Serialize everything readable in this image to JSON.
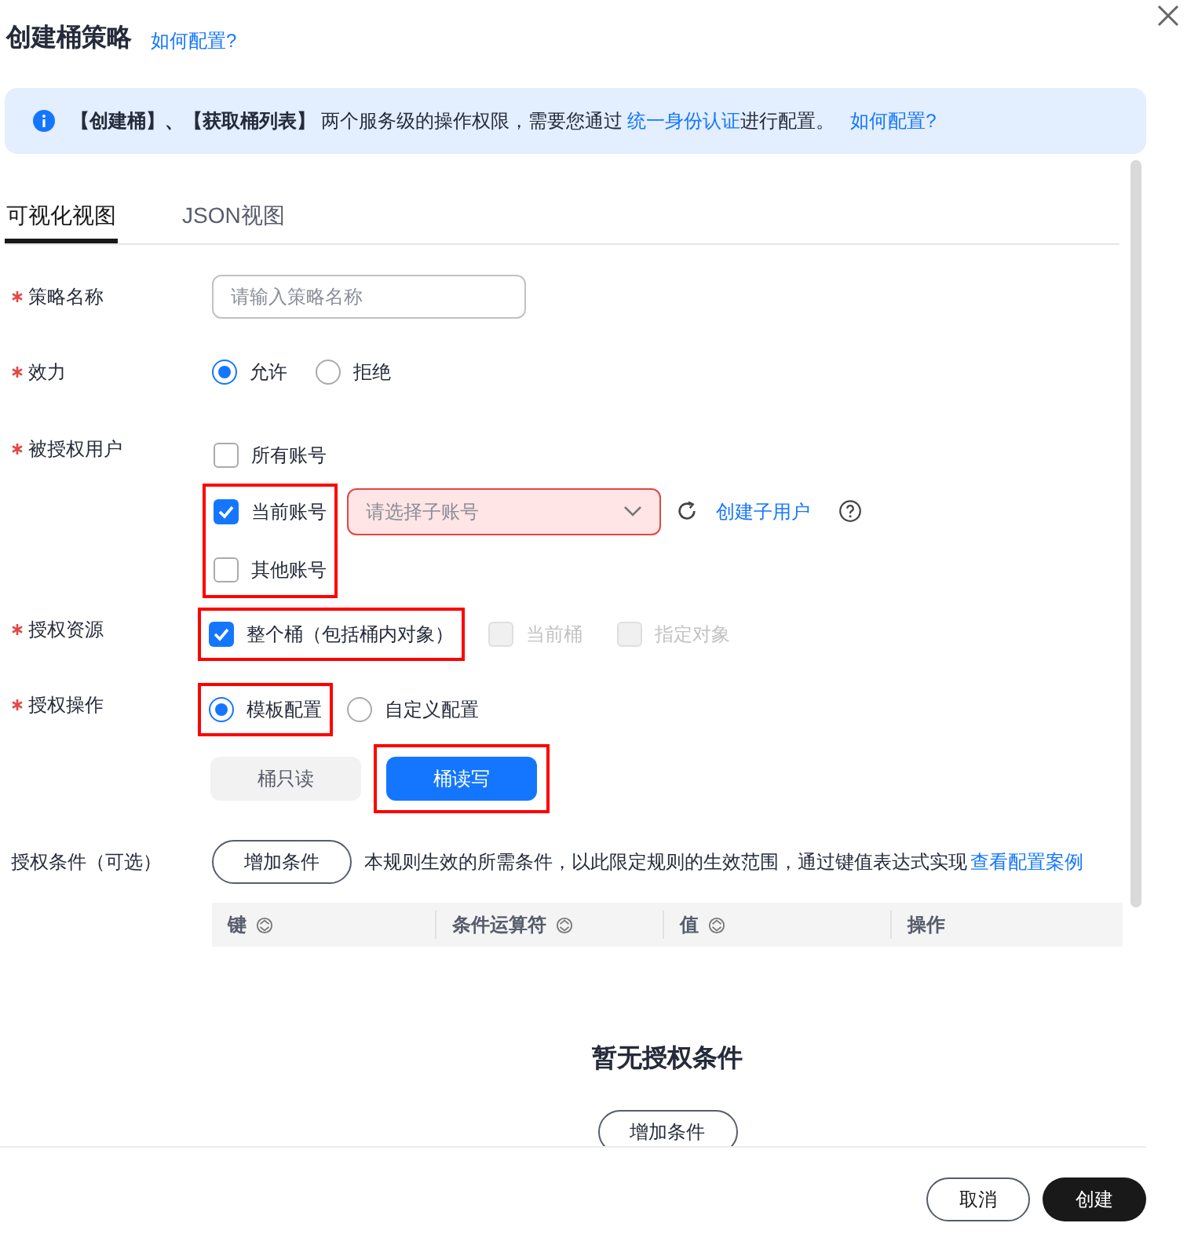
{
  "title": "创建桶策略",
  "help_link": "如何配置?",
  "notice": {
    "text": "**【创建桶】、【获取桶列表】** 两个服务级的操作权限，需要您通过 ",
    "link": "统一身份认证",
    "suffix": "进行配置。",
    "help_link": "如何配置?"
  },
  "tabs": [
    {
      "label": "可视化视图",
      "selected": true
    },
    {
      "label": "JSON视图",
      "selected": false
    }
  ],
  "policy_name": {
    "label": "策略名称",
    "required": true,
    "placeholder": "请输入策略名称"
  },
  "effect": {
    "label": "效力",
    "required": true,
    "options": [
      {
        "label": "允许",
        "selected": true
      },
      {
        "label": "拒绝",
        "selected": false
      }
    ]
  },
  "authorized_users": {
    "label": "被授权用户",
    "required": true,
    "options": [
      {
        "label": "所有账号",
        "checked": false,
        "highlighted": false
      },
      {
        "label": "当前账号",
        "checked": true,
        "highlighted": true
      },
      {
        "label": "其他账号",
        "checked": false,
        "highlighted": true
      }
    ],
    "subaccount_select": {
      "placeholder": "请选择子账号",
      "error": true
    },
    "create_link": "创建子用户"
  },
  "resources": {
    "label": "授权资源",
    "required": true,
    "options": [
      {
        "label": "整个桶（包括桶内对象）",
        "checked": true,
        "disabled": false,
        "highlighted": true
      },
      {
        "label": "当前桶",
        "checked": false,
        "disabled": true,
        "highlighted": false
      },
      {
        "label": "指定对象",
        "checked": false,
        "disabled": true,
        "highlighted": false
      }
    ]
  },
  "operations": {
    "label": "授权操作",
    "required": true,
    "options": [
      {
        "label": "模板配置",
        "selected": true,
        "highlighted": true
      },
      {
        "label": "自定义配置",
        "selected": false,
        "highlighted": false
      }
    ],
    "templates": [
      {
        "label": "桶只读",
        "selected": false,
        "highlighted": false
      },
      {
        "label": "桶读写",
        "selected": true,
        "highlighted": true
      }
    ]
  },
  "conditions": {
    "label": "授权条件（可选）",
    "required": false,
    "add_button": "增加条件",
    "description": "本规则生效的所需条件，以此限定规则的生效范围，通过键值表达式实现",
    "link": "查看配置案例",
    "columns": [
      {
        "label": "键",
        "sortable": true
      },
      {
        "label": "条件运算符",
        "sortable": true
      },
      {
        "label": "值",
        "sortable": true
      },
      {
        "label": "操作",
        "sortable": false
      }
    ],
    "empty_text": "暂无授权条件",
    "empty_button": "增加条件"
  },
  "footer_buttons": [
    {
      "label": "取消",
      "kind": "secondary"
    },
    {
      "label": "创建",
      "kind": "primary"
    }
  ]
}
